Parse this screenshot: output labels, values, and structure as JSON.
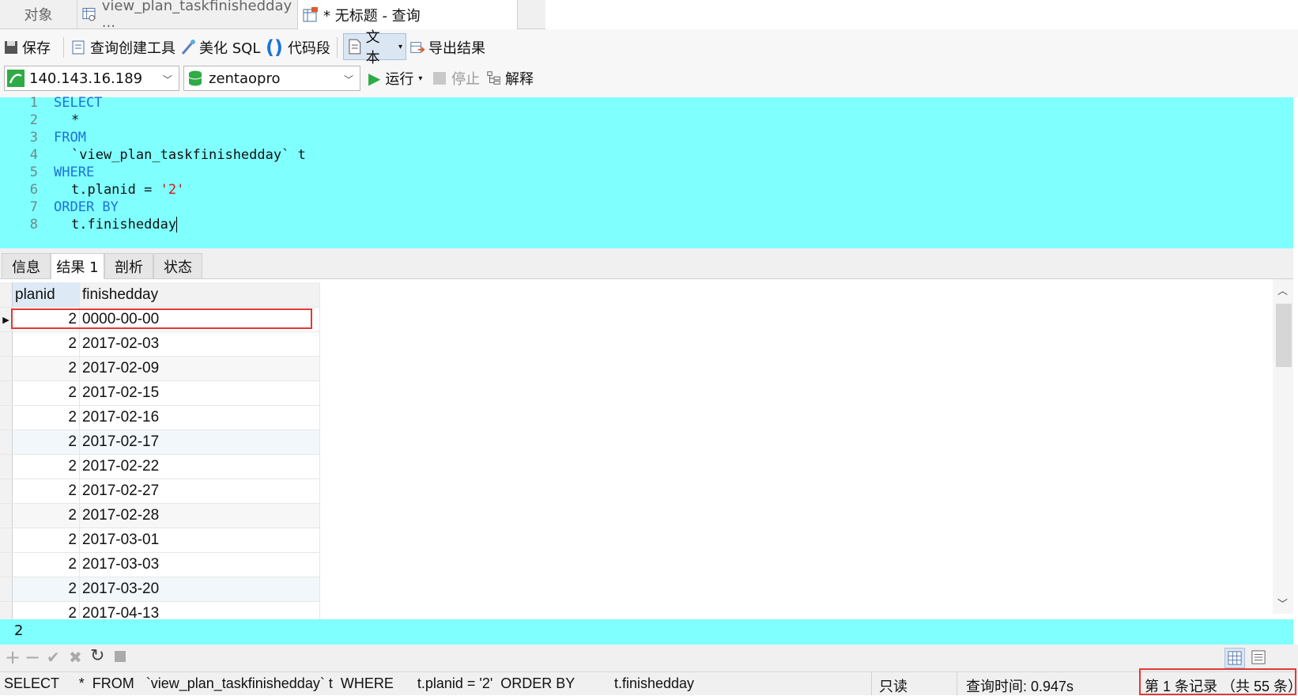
{
  "tabs": [
    {
      "label": "对象",
      "icon": "objects-icon"
    },
    {
      "label": "view_plan_taskfinishedday ...",
      "icon": "view-table-icon"
    },
    {
      "label": "* 无标题 - 查询",
      "icon": "query-table-icon"
    }
  ],
  "toolbar": {
    "save": "保存",
    "query_builder": "查询创建工具",
    "beautify": "美化 SQL",
    "snippet": "代码段",
    "text": "文本",
    "export": "导出结果"
  },
  "connection": {
    "host": "140.143.16.189",
    "database": "zentaopro",
    "run": "运行",
    "stop": "停止",
    "explain": "解释"
  },
  "editor": {
    "lines": [
      "1",
      "2",
      "3",
      "4",
      "5",
      "6",
      "7",
      "8"
    ],
    "select": "SELECT",
    "star": "*",
    "from": "FROM",
    "table": "`view_plan_taskfinishedday` t",
    "where": "WHERE",
    "cond_prefix": "t.planid = ",
    "cond_value": "'2'",
    "order_by": "ORDER BY",
    "order_col": "t.finishedday"
  },
  "result_tabs": [
    "信息",
    "结果 1",
    "剖析",
    "状态"
  ],
  "grid": {
    "columns": [
      "planid",
      "finishedday"
    ],
    "rows": [
      [
        "2",
        "0000-00-00"
      ],
      [
        "2",
        "2017-02-03"
      ],
      [
        "2",
        "2017-02-09"
      ],
      [
        "2",
        "2017-02-15"
      ],
      [
        "2",
        "2017-02-16"
      ],
      [
        "2",
        "2017-02-17"
      ],
      [
        "2",
        "2017-02-22"
      ],
      [
        "2",
        "2017-02-27"
      ],
      [
        "2",
        "2017-02-28"
      ],
      [
        "2",
        "2017-03-01"
      ],
      [
        "2",
        "2017-03-03"
      ],
      [
        "2",
        "2017-03-20"
      ],
      [
        "2",
        "2017-04-13"
      ]
    ]
  },
  "value_bar": "2",
  "status": {
    "sql": "SELECT     *  FROM   `view_plan_taskfinishedday` t  WHERE      t.planid = '2'  ORDER BY          t.finishedday",
    "readonly": "只读",
    "query_time": "查询时间: 0.947s",
    "record": "第 1 条记录 （共 55 条）"
  },
  "colors": {
    "editor_bg": "#80ffff",
    "keyword": "#1a73d8",
    "string": "#d01818",
    "highlight_box": "#e53935"
  }
}
